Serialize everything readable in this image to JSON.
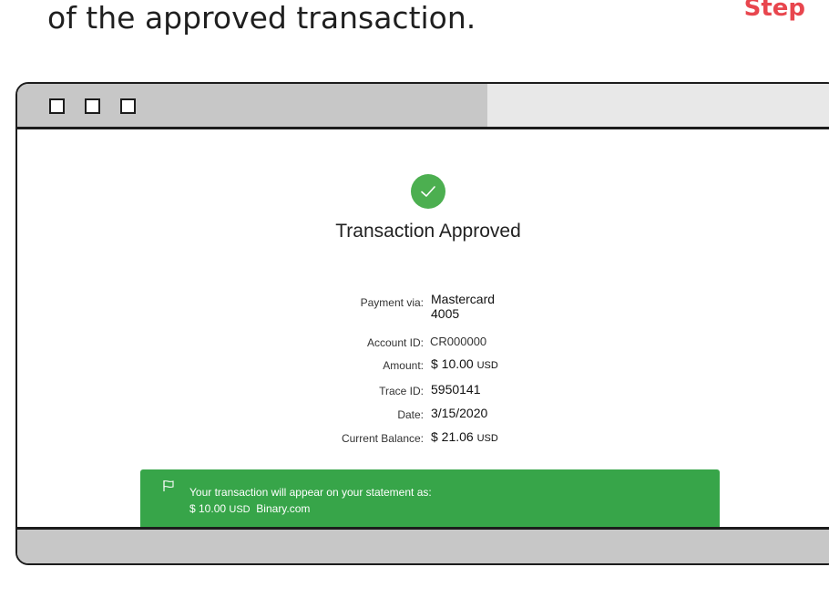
{
  "caption": {
    "text": "of the approved transaction.",
    "step": "Step"
  },
  "window": {
    "buttons": [
      "minimize",
      "maximize",
      "close"
    ]
  },
  "result": {
    "title": "Transaction Approved",
    "status_color": "#4caf50"
  },
  "details": {
    "payment_via_label": "Payment via:",
    "payment_via_value": "Mastercard",
    "payment_via_value2": "4005",
    "account_id_label": "Account ID:",
    "account_id_value": "CR000000",
    "amount_label": "Amount:",
    "amount_value": "$ 10.00",
    "amount_currency": "USD",
    "trace_id_label": "Trace ID:",
    "trace_id_value": "5950141",
    "date_label": "Date:",
    "date_value": "3/15/2020",
    "balance_label": "Current Balance:",
    "balance_value": "$ 21.06",
    "balance_currency": "USD"
  },
  "notice": {
    "icon": "flag-icon",
    "line1": "Your transaction will appear on your statement as:",
    "amount": "$ 10.00",
    "currency": "USD",
    "merchant": "Binary.com",
    "color": "#37a549"
  },
  "colors": {
    "accent": "#e8464e",
    "chrome": "#c7c7c7"
  }
}
